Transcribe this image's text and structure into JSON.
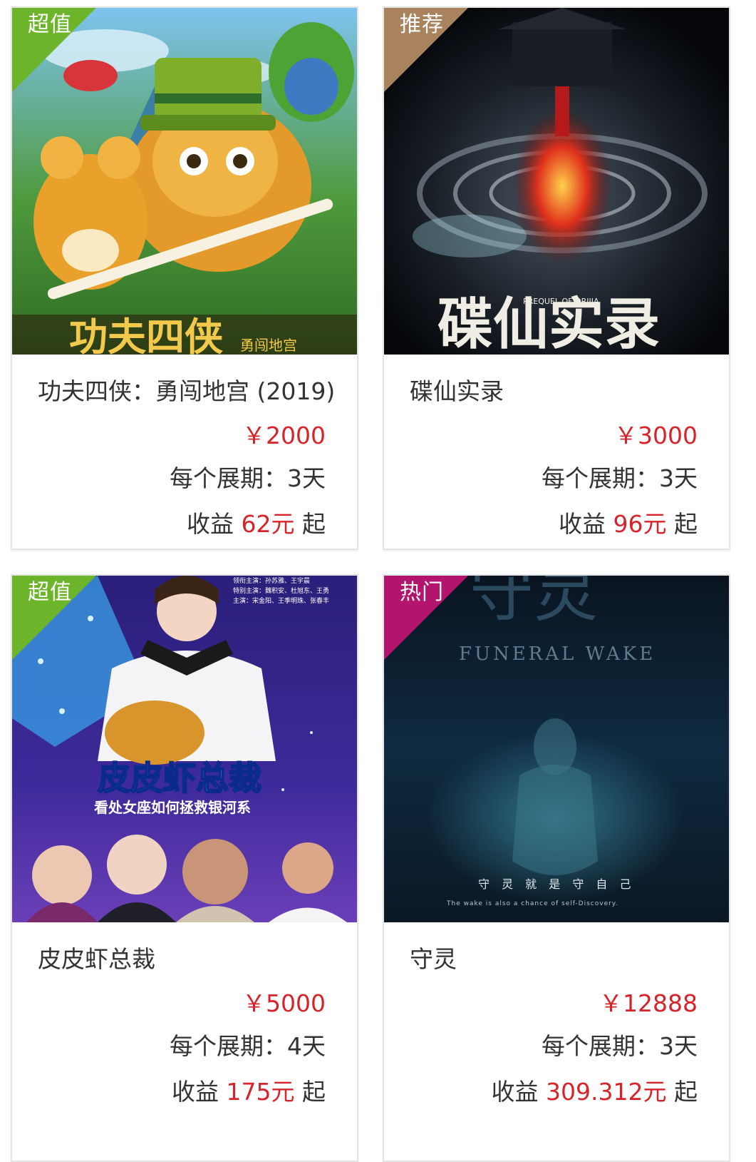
{
  "currency": "￥",
  "period_prefix": "每个展期：",
  "income_prefix": "收益 ",
  "income_suffix": " 起",
  "cards": [
    {
      "badge": "超值",
      "badge_color": "#6cb52a",
      "poster_title": "功夫四侠",
      "poster_subtitle": "勇闯地宫",
      "title": "功夫四侠：勇闯地宫 (2019)",
      "price": "2000",
      "period": "3天",
      "income_amount": "62元"
    },
    {
      "badge": "推荐",
      "badge_color": "#a8835e",
      "poster_title": "碟仙实录",
      "poster_subtitle": "PREQUEL OF ORIJIA",
      "title": "碟仙实录",
      "price": "3000",
      "period": "3天",
      "income_amount": "96元"
    },
    {
      "badge": "超值",
      "badge_color": "#6cb52a",
      "poster_title": "皮皮虾总裁",
      "poster_subtitle": "看处女座如何拯救银河系",
      "poster_credits": [
        "领衔主演：孙苏雅、王宇晨",
        "特别主演：魏积安、杜旭东、王勇",
        "主演：宋金阳、王季明珠、张春丰"
      ],
      "title": "皮皮虾总裁",
      "price": "5000",
      "period": "4天",
      "income_amount": "175元"
    },
    {
      "badge": "热门",
      "badge_color": "#b3146e",
      "poster_title": "守灵",
      "poster_subtitle": "FUNERAL WAKE",
      "poster_tagline": "守 灵 就 是 守 自 己",
      "poster_tagline_en": "The wake is also a chance of self-Discovery.",
      "title": "守灵",
      "price": "12888",
      "period": "3天",
      "income_amount": "309.312元"
    }
  ]
}
